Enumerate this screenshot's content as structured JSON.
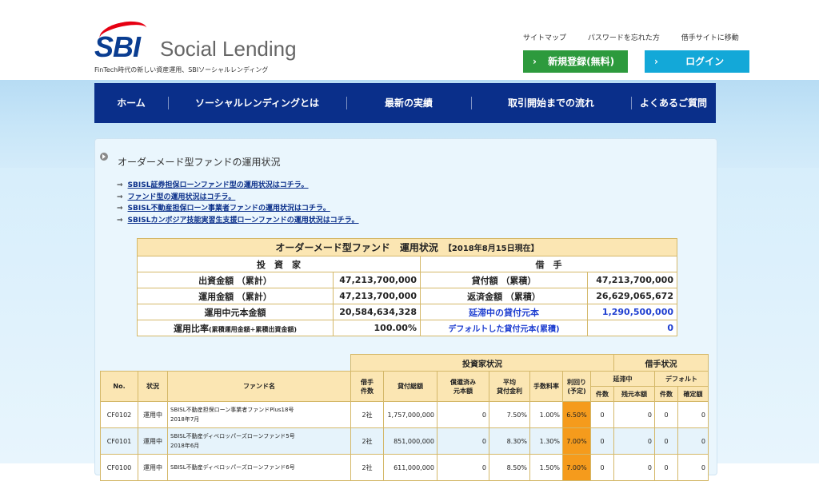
{
  "header": {
    "logo_text": "SBI",
    "logo_name": "Social Lending",
    "tagline": "FinTech時代の新しい資産運用、SBIソーシャルレンディング",
    "top_links": [
      "サイトマップ",
      "パスワードを忘れた方",
      "借手サイトに移動"
    ],
    "register_button": "新規登録(無料)",
    "login_button": "ログイン",
    "arrow": "›"
  },
  "nav": [
    "ホーム",
    "ソーシャルレンディングとは",
    "最新の実績",
    "取引開始までの流れ",
    "よくあるご質問"
  ],
  "page": {
    "title": "オーダーメード型ファンドの運用状況",
    "link_arrow": "⇒",
    "links": [
      "SBISL証券担保ローンファンド型の運用状況はコチラ。",
      "ファンド型の運用状況はコチラ。",
      "SBISL不動産担保ローン事業者ファンドの運用状況はコチラ。",
      "SBISLカンボジア技能実習生支援ローンファンドの運用状況はコチラ。"
    ]
  },
  "summary": {
    "title": "オーダーメード型ファンド　運用状況",
    "date": "【2018年8月15日現在】",
    "investor_header": "投　資　家",
    "borrower_header": "借　手",
    "rows": [
      {
        "label": "出資金額 （累計）",
        "value": "47,213,700,000",
        "blabel": "貸付額 （累積）",
        "bvalue": "47,213,700,000"
      },
      {
        "label": "運用金額 （累計）",
        "value": "47,213,700,000",
        "blabel": "返済金額 （累積）",
        "bvalue": "26,629,065,672"
      },
      {
        "label": "運用中元本金額",
        "value": "20,584,634,328",
        "blabel": "延滞中の貸付元本",
        "bvalue": "1,290,500,000"
      }
    ],
    "ratio_label": "運用比率",
    "ratio_note": "(累積運用金額÷累積出資金額)",
    "ratio_value": "100.00%",
    "default_label": "デフォルトした貸付元本(累積)",
    "default_value": "0"
  },
  "funds_table": {
    "group_investor": "投資家状況",
    "group_borrower": "借手状況",
    "headers": {
      "no": "No.",
      "status": "状況",
      "fund_name": "ファンド名",
      "borrowers_1": "借手",
      "borrowers_2": "件数",
      "loan_total": "貸付総額",
      "repaid_1": "償還済み",
      "repaid_2": "元本額",
      "avg_1": "平均",
      "avg_2": "貸付金利",
      "fee": "手数料率",
      "yield_1": "利回り",
      "yield_2": "(予定)",
      "delinquent": "延滞中",
      "default": "デフォルト",
      "count": "件数",
      "remaining": "残元本額",
      "confirmed": "確定額"
    },
    "rows": [
      {
        "no": "CF0102",
        "status": "運用中",
        "name1": "SBISL不動産担保ローン事業者ファンドPlus18号",
        "name2": "2018年7月",
        "borrowers": "2社",
        "total": "1,757,000,000",
        "repaid": "0",
        "rate": "7.50%",
        "fee": "1.00%",
        "yield": "6.50%",
        "d_count": "0",
        "d_amount": "0",
        "df_count": "0",
        "df_amount": "0"
      },
      {
        "no": "CF0101",
        "status": "運用中",
        "name1": "SBISL不動産ディベロッパーズローンファンド5号",
        "name2": "2018年6月",
        "borrowers": "2社",
        "total": "851,000,000",
        "repaid": "0",
        "rate": "8.30%",
        "fee": "1.30%",
        "yield": "7.00%",
        "d_count": "0",
        "d_amount": "0",
        "df_count": "0",
        "df_amount": "0"
      },
      {
        "no": "CF0100",
        "status": "運用中",
        "name1": "SBISL不動産ディベロッパーズローンファンド6号",
        "name2": "",
        "borrowers": "2社",
        "total": "611,000,000",
        "repaid": "0",
        "rate": "8.50%",
        "fee": "1.50%",
        "yield": "7.00%",
        "d_count": "0",
        "d_amount": "0",
        "df_count": "0",
        "df_amount": "0"
      }
    ]
  }
}
